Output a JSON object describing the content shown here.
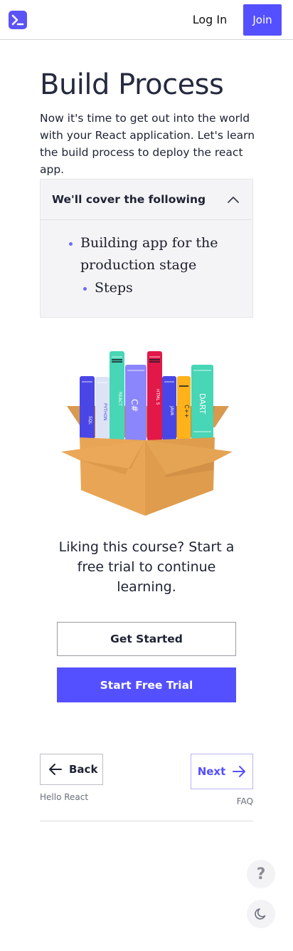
{
  "header": {
    "logo_icon": "terminal-icon",
    "login_label": "Log In",
    "join_label": "Join",
    "brand_color": "#5550ff"
  },
  "page": {
    "title": "Build Process",
    "intro": "Now it's time to get out into the world with your React application. Let's learn the build process to deploy the react app."
  },
  "accordion": {
    "title": "We'll cover the following",
    "expanded": true,
    "icon": "chevron-up-icon",
    "topics": [
      {
        "label": "Building app for the production stage",
        "level": 1
      },
      {
        "label": "Steps",
        "level": 2
      }
    ]
  },
  "illustration": {
    "name": "books-in-box",
    "book_labels": [
      "SQL",
      "PYTHON",
      "REACT",
      "C#",
      "HTML 5",
      "JAVA",
      "C++",
      "DART"
    ]
  },
  "promo": {
    "text": "Liking this course? Start a free trial to continue learning.",
    "get_started_label": "Get Started",
    "free_trial_label": "Start Free Trial"
  },
  "navigation": {
    "back_label": "Back",
    "back_subtitle": "Hello React",
    "next_label": "Next",
    "next_subtitle": "FAQ"
  },
  "floating": {
    "help_label": "?",
    "help_icon": "question-icon",
    "theme_icon": "moon-icon"
  }
}
